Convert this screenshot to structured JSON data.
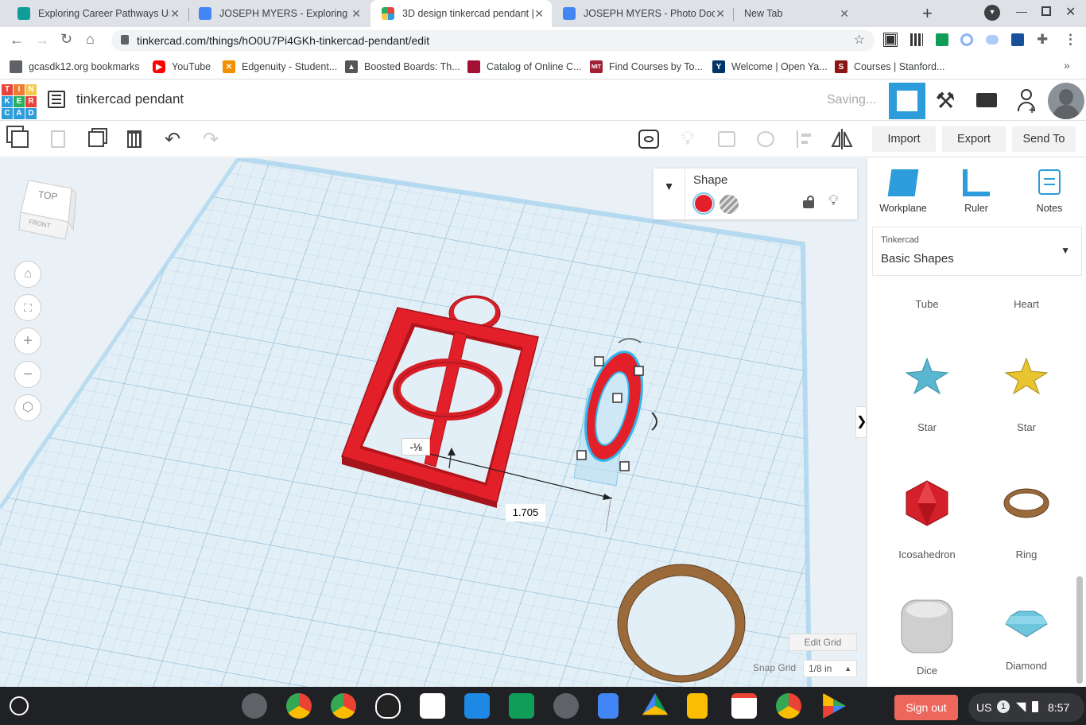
{
  "browser": {
    "tabs": [
      {
        "title": "Exploring Career Pathways Us",
        "color": "#0f9d9a"
      },
      {
        "title": "JOSEPH MYERS - Exploring Ca",
        "color": "#4285f4"
      },
      {
        "title": "3D design tinkercad pendant |",
        "color": "#e8433b"
      },
      {
        "title": "JOSEPH MYERS - Photo Docum",
        "color": "#4285f4"
      },
      {
        "title": "New Tab",
        "color": ""
      }
    ],
    "url": "tinkercad.com/things/hO0U7Pi4GKh-tinkercad-pendant/edit",
    "bookmarks": [
      {
        "label": "gcasdk12.org bookmarks",
        "icon": "folder-icon"
      },
      {
        "label": "YouTube",
        "icon": "youtube-icon"
      },
      {
        "label": "Edgenuity - Student...",
        "icon": "edgenuity-icon"
      },
      {
        "label": "Boosted Boards: Th...",
        "icon": "boosted-icon"
      },
      {
        "label": "Catalog of Online C...",
        "icon": "harvard-icon"
      },
      {
        "label": "Find Courses by To...",
        "icon": "mit-icon"
      },
      {
        "label": "Welcome | Open Ya...",
        "icon": "yale-icon"
      },
      {
        "label": "Courses | Stanford...",
        "icon": "stanford-icon"
      }
    ]
  },
  "tinkercad": {
    "logo_letters": [
      "T",
      "I",
      "N",
      "K",
      "E",
      "R",
      "C",
      "A",
      "D"
    ],
    "design_name": "tinkercad pendant",
    "status": "Saving...",
    "toolbar": {
      "import_label": "Import",
      "export_label": "Export",
      "send_to_label": "Send To"
    },
    "shape_inspector": {
      "title": "Shape",
      "solid_color": "#e3202a"
    },
    "viewcube": {
      "top": "TOP",
      "front": "FRONT"
    },
    "dimensions": {
      "distance": "1.705",
      "offset": "-⅛"
    },
    "grid": {
      "edit_grid_label": "Edit Grid",
      "snap_grid_label": "Snap Grid",
      "snap_grid_value": "1/8 in"
    },
    "panel": {
      "tools": [
        {
          "label": "Workplane",
          "icon": "workplane-icon"
        },
        {
          "label": "Ruler",
          "icon": "ruler-icon"
        },
        {
          "label": "Notes",
          "icon": "notes-icon"
        }
      ],
      "library_source": "Tinkercad",
      "library_name": "Basic Shapes",
      "shapes": [
        {
          "label": "Tube"
        },
        {
          "label": "Heart"
        },
        {
          "label": "Star"
        },
        {
          "label": "Star"
        },
        {
          "label": "Icosahedron"
        },
        {
          "label": "Ring"
        },
        {
          "label": "Dice"
        },
        {
          "label": "Diamond"
        }
      ]
    }
  },
  "taskbar": {
    "sign_out_label": "Sign out",
    "locale": "US",
    "notification_count": "1",
    "time": "8:57"
  }
}
